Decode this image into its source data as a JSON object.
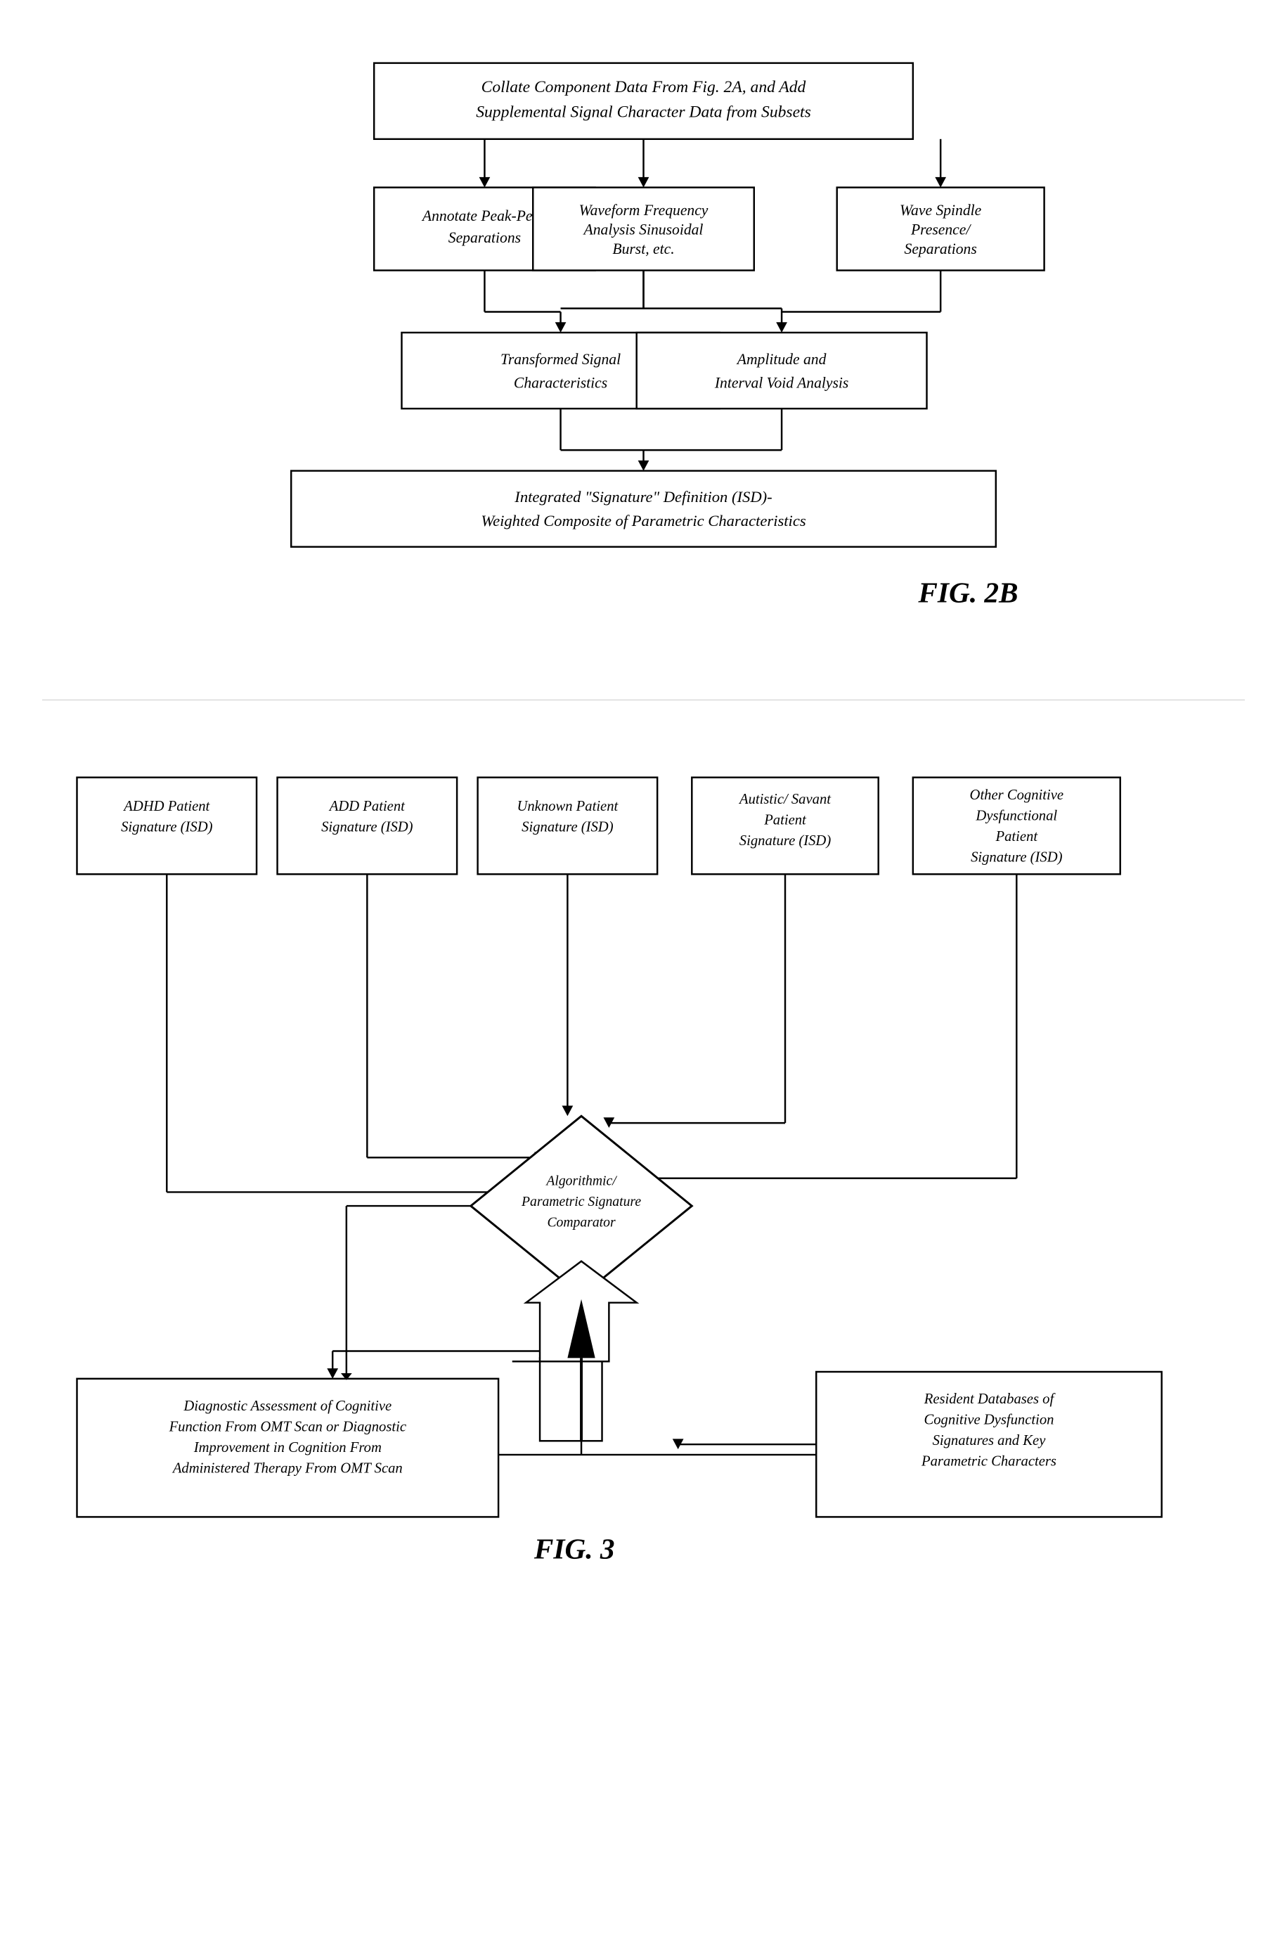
{
  "fig2b": {
    "title": "FIG. 2B",
    "top_box": "Collate Component Data From Fig. 2A, and Add\nSupplemental Signal Character Data from Subsets",
    "box1": "Annotate Peak-Peak\nSeparations",
    "box2": "Waveform Frequency\nAnalysis Sinusoidal\nBurst, etc.",
    "box3": "Wave Spindle\nPresence/\nSeparations",
    "box4": "Transformed Signal\nCharacteristics",
    "box5": "Amplitude and\nInterval Void Analysis",
    "bottom_box": "Integrated \"Signature\" Definition (ISD)-\nWeighted Composite of Parametric Characteristics"
  },
  "fig3": {
    "title": "FIG. 3",
    "adhd_box": "ADHD Patient\nSignature (ISD)",
    "add_box": "ADD Patient\nSignature (ISD)",
    "unknown_box": "Unknown Patient\nSignature (ISD)",
    "autistic_box": "Autistic/ Savant\nPatient\nSignature (ISD)",
    "other_box": "Other Cognitive\nDysfunctional\nPatient\nSignature (ISD)",
    "comparator": "Algorithmic/\nParametric Signature\nComparator",
    "diagnostic_box": "Diagnostic Assessment of Cognitive\nFunction From OMT Scan or Diagnostic\nImprovement in Cognition From\nAdministered Therapy From OMT Scan",
    "resident_db": "Resident Databases of\nCognitive Dysfunction\nSignatures and Key\nParametric Characters"
  }
}
